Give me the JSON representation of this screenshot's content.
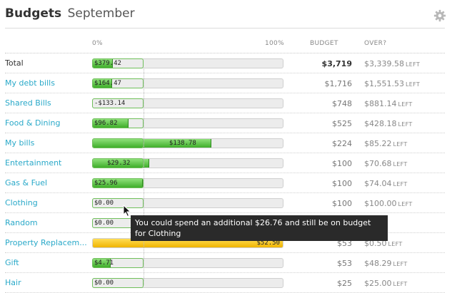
{
  "header": {
    "title_bold": "Budgets",
    "title_month": "September",
    "settings_icon": "gear-icon"
  },
  "columns": {
    "zero_pct": "0%",
    "hundred_pct": "100%",
    "budget": "BUDGET",
    "over": "OVER?"
  },
  "left_word": "LEFT",
  "rows": [
    {
      "name": "Total",
      "spent": "$379.42",
      "budget": "$3,719",
      "over": "$3,339.58",
      "fill": 0.102,
      "status": "under",
      "link": false
    },
    {
      "name": "My debt bills",
      "spent": "$164.47",
      "budget": "$1,716",
      "over": "$1,551.53",
      "fill": 0.096,
      "status": "under",
      "link": true
    },
    {
      "name": "Shared Bills",
      "spent": "-$133.14",
      "budget": "$748",
      "over": "$881.14",
      "fill": 0,
      "status": "under",
      "link": true
    },
    {
      "name": "Food & Dining",
      "spent": "$96.82",
      "budget": "$525",
      "over": "$428.18",
      "fill": 0.184,
      "status": "under",
      "link": true
    },
    {
      "name": "My bills",
      "spent": "$138.78",
      "budget": "$224",
      "over": "$85.22",
      "fill": 0.62,
      "status": "under",
      "link": true
    },
    {
      "name": "Entertainment",
      "spent": "$29.32",
      "budget": "$100",
      "over": "$70.68",
      "fill": 0.293,
      "status": "under",
      "link": true
    },
    {
      "name": "Gas & Fuel",
      "spent": "$25.96",
      "budget": "$100",
      "over": "$74.04",
      "fill": 0.26,
      "status": "under",
      "link": true
    },
    {
      "name": "Clothing",
      "spent": "$0.00",
      "budget": "$100",
      "over": "$100.00",
      "fill": 0,
      "status": "under",
      "link": true
    },
    {
      "name": "Random",
      "spent": "$0.00",
      "budget": "",
      "over": "",
      "fill": 0,
      "status": "under",
      "link": true
    },
    {
      "name": "Property Replacem...",
      "spent": "$52.50",
      "budget": "$53",
      "over": "$0.50",
      "fill": 1.0,
      "status": "over",
      "link": true
    },
    {
      "name": "Gift",
      "spent": "$4.71",
      "budget": "$53",
      "over": "$48.29",
      "fill": 0.089,
      "status": "under",
      "link": true
    },
    {
      "name": "Hair",
      "spent": "$0.00",
      "budget": "$25",
      "over": "$25.00",
      "fill": 0,
      "status": "under",
      "link": true
    }
  ],
  "tooltip": {
    "text": "You could spend an additional $26.76 and still be on budget for Clothing"
  },
  "colors": {
    "link": "#2aa9c9",
    "fill_green": "#3fae2a",
    "fill_over": "#f0b400"
  }
}
